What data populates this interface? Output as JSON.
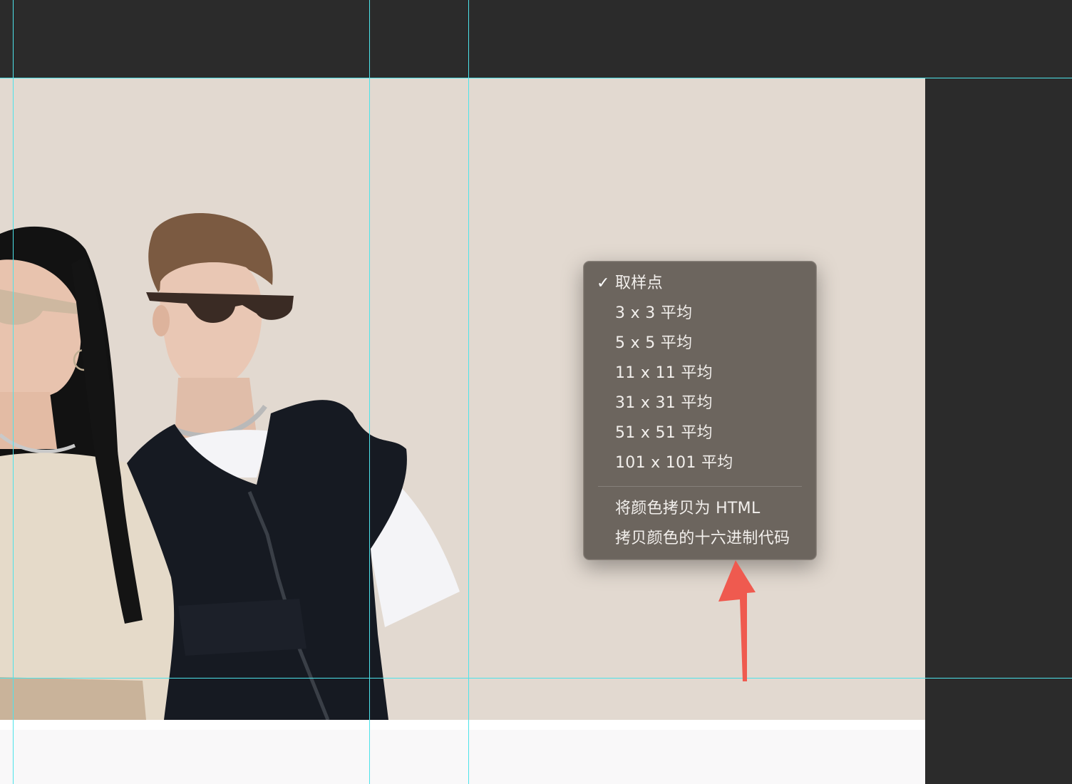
{
  "app": {
    "canvas_background": "#e2d9d0",
    "workspace_background": "#2b2b2b",
    "guide_color": "#4de3ea"
  },
  "photo": {
    "subject": "two-models-wearing-glasses"
  },
  "context_menu": {
    "items": [
      {
        "label": "取样点",
        "checked": true
      },
      {
        "label": "3 x 3 平均",
        "checked": false
      },
      {
        "label": "5 x 5 平均",
        "checked": false
      },
      {
        "label": "11 x 11 平均",
        "checked": false
      },
      {
        "label": "31 x 31 平均",
        "checked": false
      },
      {
        "label": "51 x 51 平均",
        "checked": false
      },
      {
        "label": "101 x 101 平均",
        "checked": false
      }
    ],
    "actions": [
      {
        "label": "将颜色拷贝为 HTML"
      },
      {
        "label": "拷贝颜色的十六进制代码"
      }
    ],
    "check_glyph": "✓"
  },
  "annotation": {
    "arrow_color": "#ef5a4f"
  }
}
